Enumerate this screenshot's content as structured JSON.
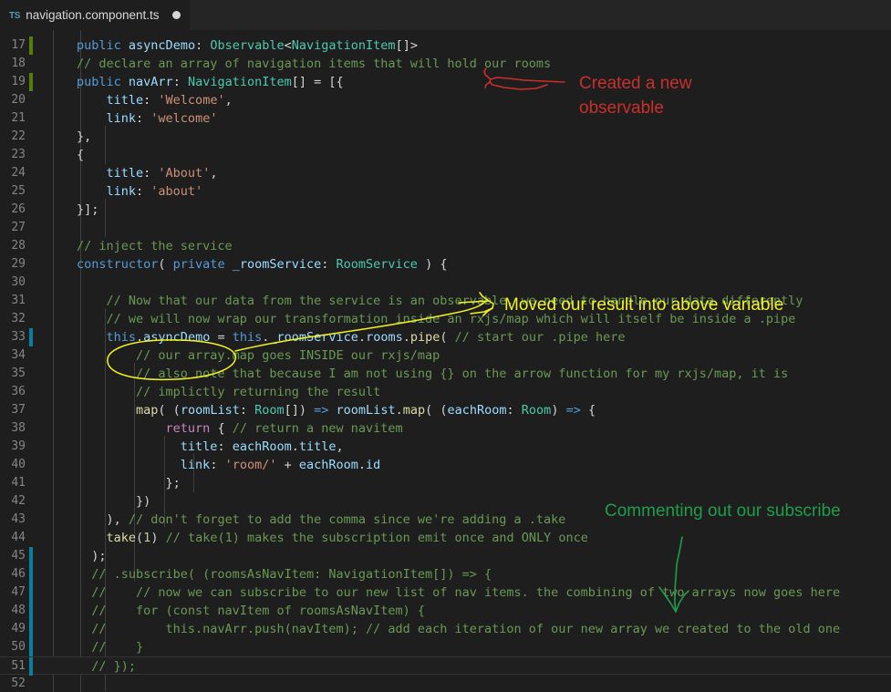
{
  "window": {
    "background": "#1e1e1e",
    "tabbar_background": "#252526"
  },
  "tabbar": {
    "icon": "typescript-file-icon",
    "icon_label": "TS",
    "filename": "navigation.component.ts",
    "dirty_indicator": "unsaved-changes-dot"
  },
  "editor": {
    "first_visible_line": 16,
    "last_visible_line": 52,
    "current_line": 51,
    "language": "TypeScript",
    "lines": [
      {
        "n": 17,
        "gutter": "added",
        "tokens": [
          [
            "kw",
            "public"
          ],
          [
            "op",
            " "
          ],
          [
            "id",
            "asyncDemo"
          ],
          [
            "op",
            ": "
          ],
          [
            "ty",
            "Observable"
          ],
          [
            "op",
            "<"
          ],
          [
            "ty",
            "NavigationItem"
          ],
          [
            "op",
            "[]>"
          ]
        ]
      },
      {
        "n": 18,
        "gutter": "",
        "tokens": [
          [
            "cmt",
            "// declare an array of navigation items that will hold our rooms"
          ]
        ]
      },
      {
        "n": 19,
        "gutter": "added",
        "tokens": [
          [
            "kw",
            "public"
          ],
          [
            "op",
            " "
          ],
          [
            "id",
            "navArr"
          ],
          [
            "op",
            ": "
          ],
          [
            "ty",
            "NavigationItem"
          ],
          [
            "op",
            "[] = [{"
          ]
        ]
      },
      {
        "n": 20,
        "gutter": "",
        "tokens": [
          [
            "op",
            "    "
          ],
          [
            "id",
            "title"
          ],
          [
            "op",
            ": "
          ],
          [
            "str",
            "'Welcome'"
          ],
          [
            "op",
            ","
          ]
        ]
      },
      {
        "n": 21,
        "gutter": "",
        "tokens": [
          [
            "op",
            "    "
          ],
          [
            "id",
            "link"
          ],
          [
            "op",
            ": "
          ],
          [
            "str",
            "'welcome'"
          ]
        ]
      },
      {
        "n": 22,
        "gutter": "",
        "tokens": [
          [
            "op",
            "},"
          ]
        ]
      },
      {
        "n": 23,
        "gutter": "",
        "tokens": [
          [
            "op",
            "{"
          ]
        ]
      },
      {
        "n": 24,
        "gutter": "",
        "tokens": [
          [
            "op",
            "    "
          ],
          [
            "id",
            "title"
          ],
          [
            "op",
            ": "
          ],
          [
            "str",
            "'About'"
          ],
          [
            "op",
            ","
          ]
        ]
      },
      {
        "n": 25,
        "gutter": "",
        "tokens": [
          [
            "op",
            "    "
          ],
          [
            "id",
            "link"
          ],
          [
            "op",
            ": "
          ],
          [
            "str",
            "'about'"
          ]
        ]
      },
      {
        "n": 26,
        "gutter": "",
        "tokens": [
          [
            "op",
            "}];"
          ]
        ]
      },
      {
        "n": 27,
        "gutter": "",
        "tokens": []
      },
      {
        "n": 28,
        "gutter": "",
        "tokens": [
          [
            "cmt",
            "// inject the service"
          ]
        ]
      },
      {
        "n": 29,
        "gutter": "",
        "tokens": [
          [
            "kw",
            "constructor"
          ],
          [
            "op",
            "( "
          ],
          [
            "kw",
            "private"
          ],
          [
            "op",
            " "
          ],
          [
            "id",
            "_roomService"
          ],
          [
            "op",
            ": "
          ],
          [
            "ty",
            "RoomService"
          ],
          [
            "op",
            " ) {"
          ]
        ]
      },
      {
        "n": 30,
        "gutter": "",
        "tokens": []
      },
      {
        "n": 31,
        "gutter": "",
        "tokens": [
          [
            "cmt",
            "    // Now that our data from the service is an observable, we need to handle our data differently"
          ]
        ]
      },
      {
        "n": 32,
        "gutter": "",
        "tokens": [
          [
            "cmt",
            "    // we will now wrap our transformation inside an rxjs/map which will itself be inside a .pipe"
          ]
        ]
      },
      {
        "n": 33,
        "gutter": "modified",
        "tokens": [
          [
            "op",
            "    "
          ],
          [
            "kw",
            "this"
          ],
          [
            "op",
            "."
          ],
          [
            "id",
            "asyncDemo"
          ],
          [
            "op",
            " = "
          ],
          [
            "kw",
            "this"
          ],
          [
            "op",
            "."
          ],
          [
            "id",
            "_roomService"
          ],
          [
            "op",
            "."
          ],
          [
            "id",
            "rooms"
          ],
          [
            "op",
            "."
          ],
          [
            "fn",
            "pipe"
          ],
          [
            "op",
            "( "
          ],
          [
            "cmt",
            "// start our .pipe here"
          ]
        ]
      },
      {
        "n": 34,
        "gutter": "",
        "tokens": [
          [
            "cmt",
            "        // our array.map goes INSIDE our rxjs/map"
          ]
        ]
      },
      {
        "n": 35,
        "gutter": "",
        "tokens": [
          [
            "cmt",
            "        // also note that because I am not using {} on the arrow function for my rxjs/map, it is"
          ]
        ]
      },
      {
        "n": 36,
        "gutter": "",
        "tokens": [
          [
            "cmt",
            "        // implictly returning the result"
          ]
        ]
      },
      {
        "n": 37,
        "gutter": "",
        "tokens": [
          [
            "op",
            "        "
          ],
          [
            "fn",
            "map"
          ],
          [
            "op",
            "( ("
          ],
          [
            "id",
            "roomList"
          ],
          [
            "op",
            ": "
          ],
          [
            "ty",
            "Room"
          ],
          [
            "op",
            "[]) "
          ],
          [
            "kw",
            "=>"
          ],
          [
            "op",
            " "
          ],
          [
            "id",
            "roomList"
          ],
          [
            "op",
            "."
          ],
          [
            "fn",
            "map"
          ],
          [
            "op",
            "( ("
          ],
          [
            "id",
            "eachRoom"
          ],
          [
            "op",
            ": "
          ],
          [
            "ty",
            "Room"
          ],
          [
            "op",
            ") "
          ],
          [
            "kw",
            "=>"
          ],
          [
            "op",
            " {"
          ]
        ]
      },
      {
        "n": 38,
        "gutter": "",
        "tokens": [
          [
            "op",
            "            "
          ],
          [
            "ctl",
            "return"
          ],
          [
            "op",
            " { "
          ],
          [
            "cmt",
            "// return a new navitem"
          ]
        ]
      },
      {
        "n": 39,
        "gutter": "",
        "tokens": [
          [
            "op",
            "              "
          ],
          [
            "id",
            "title"
          ],
          [
            "op",
            ": "
          ],
          [
            "id",
            "eachRoom"
          ],
          [
            "op",
            "."
          ],
          [
            "id",
            "title"
          ],
          [
            "op",
            ","
          ]
        ]
      },
      {
        "n": 40,
        "gutter": "",
        "tokens": [
          [
            "op",
            "              "
          ],
          [
            "id",
            "link"
          ],
          [
            "op",
            ": "
          ],
          [
            "str",
            "'room/'"
          ],
          [
            "op",
            " + "
          ],
          [
            "id",
            "eachRoom"
          ],
          [
            "op",
            "."
          ],
          [
            "id",
            "id"
          ]
        ]
      },
      {
        "n": 41,
        "gutter": "",
        "tokens": [
          [
            "op",
            "            };"
          ]
        ]
      },
      {
        "n": 42,
        "gutter": "",
        "tokens": [
          [
            "op",
            "        })"
          ]
        ]
      },
      {
        "n": 43,
        "gutter": "",
        "tokens": [
          [
            "op",
            "    ), "
          ],
          [
            "cmt",
            "// don't forget to add the comma since we're adding a .take"
          ]
        ]
      },
      {
        "n": 44,
        "gutter": "",
        "tokens": [
          [
            "op",
            "    "
          ],
          [
            "fn",
            "take"
          ],
          [
            "op",
            "("
          ],
          [
            "num",
            "1"
          ],
          [
            "op",
            ") "
          ],
          [
            "cmt",
            "// take(1) makes the subscription emit once and ONLY once"
          ]
        ]
      },
      {
        "n": 45,
        "gutter": "modified",
        "tokens": [
          [
            "op",
            "  );"
          ]
        ]
      },
      {
        "n": 46,
        "gutter": "modified",
        "tokens": [
          [
            "cmt",
            "  // .subscribe( (roomsAsNavItem: NavigationItem[]) => {"
          ]
        ]
      },
      {
        "n": 47,
        "gutter": "modified",
        "tokens": [
          [
            "cmt",
            "  //    // now we can subscribe to our new list of nav items. the combining of two arrays now goes here"
          ]
        ]
      },
      {
        "n": 48,
        "gutter": "modified",
        "tokens": [
          [
            "cmt",
            "  //    for (const navItem of roomsAsNavItem) {"
          ]
        ]
      },
      {
        "n": 49,
        "gutter": "modified",
        "tokens": [
          [
            "cmt",
            "  //        this.navArr.push(navItem); // add each iteration of our new array we created to the old one"
          ]
        ]
      },
      {
        "n": 50,
        "gutter": "modified",
        "tokens": [
          [
            "cmt",
            "  //    }"
          ]
        ]
      },
      {
        "n": 51,
        "gutter": "modified",
        "tokens": [
          [
            "cmt",
            "  // });"
          ]
        ]
      },
      {
        "n": 52,
        "gutter": "",
        "tokens": []
      }
    ]
  },
  "annotations": [
    {
      "id": "created-observable",
      "text_line1": "Created a new",
      "text_line2": "observable",
      "color": "#c9302c",
      "shape": "arrow-pointing-left"
    },
    {
      "id": "moved-result",
      "text_line1": "Moved our result into above variable",
      "text_line2": "",
      "color": "#f2f31f",
      "shape": "arrow-pointing-left-with-ellipse"
    },
    {
      "id": "commenting-subscribe",
      "text_line1": "Commenting out our subscribe",
      "text_line2": "",
      "color": "#1e9e4a",
      "shape": "arrow-pointing-down"
    }
  ],
  "colors": {
    "keyword": "#569cd6",
    "identifier": "#9cdcfe",
    "type": "#4ec9b0",
    "string": "#ce9178",
    "comment": "#6a9955",
    "function": "#dcdcaa",
    "control": "#c586c0",
    "number": "#b5cea8",
    "gutter_added": "#587c0c",
    "gutter_modified": "#0c7d9d"
  }
}
